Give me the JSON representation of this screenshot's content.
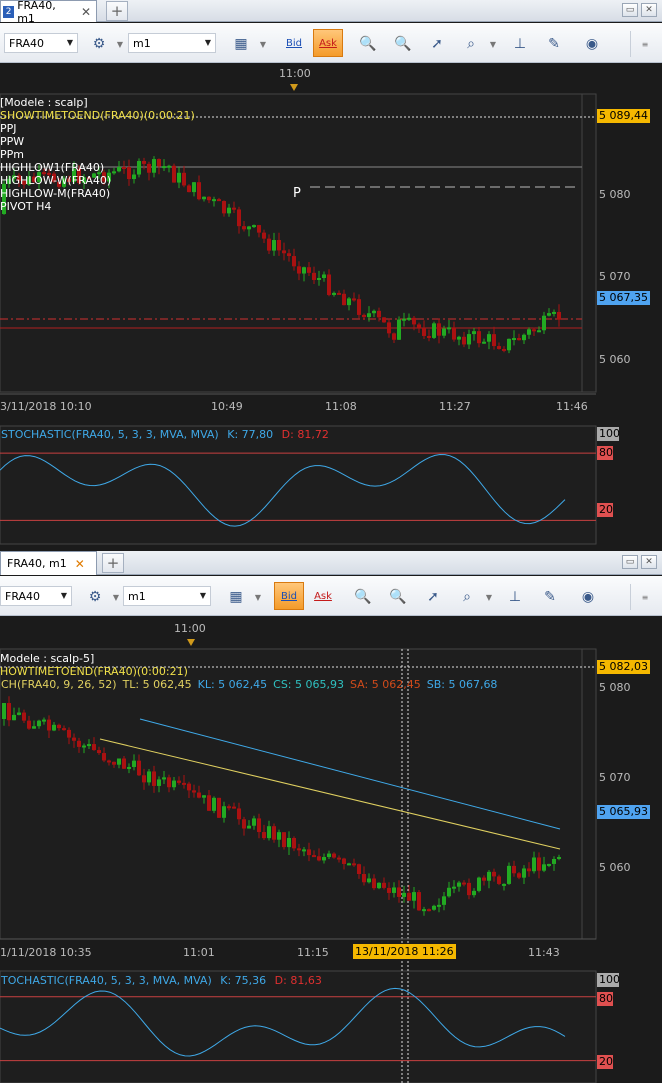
{
  "panel1": {
    "tab": {
      "num": "2",
      "title": "FRA40, m1",
      "close": "✕"
    },
    "add": "+",
    "window_buttons": [
      "▭",
      "✕"
    ],
    "toolbar": {
      "symbol": "FRA40",
      "timeframe": "m1",
      "bid": "Bid",
      "ask": "Ask",
      "bid_active": false,
      "ask_active": true
    },
    "top_time": "11:00",
    "labels": [
      "[Modele : scalp]",
      "SHOWTIMETOEND(FRA40)(0:00:21)",
      "PPJ",
      "PPW",
      "PPm",
      "HIGHLOW1(FRA40)",
      "HIGHLOW-W(FRA40)",
      "HIGHLOW-M(FRA40)",
      "PIVOT H4"
    ],
    "label_colors": [
      "#ffffff",
      "#f0e04a",
      "#ffffff",
      "#ffffff",
      "#ffffff",
      "#ffffff",
      "#ffffff",
      "#ffffff",
      "#ffffff"
    ],
    "pivot_marker": "P",
    "price_tags": [
      {
        "text": "5 089,44",
        "bg": "#f5b800"
      },
      {
        "text": "5 067,35",
        "bg": "#4fa3f0"
      }
    ],
    "price_axis": [
      "5 080",
      "5 070",
      "5 060"
    ],
    "time_axis": [
      "3/11/2018 10:10",
      "10:49",
      "11:08",
      "11:27",
      "11:46"
    ],
    "stoch": {
      "label": "STOCHASTIC(FRA40, 5, 3, 3, MVA, MVA)",
      "k_label": "K: 77,80",
      "d_label": "D: 81,72",
      "levels": [
        "100",
        "80",
        "20"
      ]
    }
  },
  "panel2": {
    "tab": {
      "num": "",
      "title": "FRA40, m1",
      "close": "✕"
    },
    "add": "+",
    "window_buttons": [
      "▭",
      "✕"
    ],
    "toolbar": {
      "symbol": "FRA40",
      "timeframe": "m1",
      "bid": "Bid",
      "ask": "Ask",
      "bid_active": true,
      "ask_active": false
    },
    "top_time": "11:00",
    "labels": [
      "Modele : scalp-5]",
      "HOWTIMETOEND(FRA40)(0:00:21)"
    ],
    "label_colors": [
      "#ffffff",
      "#f0e04a"
    ],
    "ich_line": [
      {
        "text": "CH(FRA40, 9, 26, 52)",
        "color": "#e0d060"
      },
      {
        "text": "TL: 5 062,45",
        "color": "#e0d060"
      },
      {
        "text": "KL: 5 062,45",
        "color": "#3fa9e8"
      },
      {
        "text": "CS: 5 065,93",
        "color": "#2fc0c0"
      },
      {
        "text": "SA: 5 062,45",
        "color": "#d04a1a"
      },
      {
        "text": "SB: 5 067,68",
        "color": "#3fa9e8"
      }
    ],
    "price_tags": [
      {
        "text": "5 082,03",
        "bg": "#f5b800"
      },
      {
        "text": "5 065,93",
        "bg": "#4fa3f0"
      }
    ],
    "price_axis": [
      "5 080",
      "5 070",
      "5 060"
    ],
    "time_axis": [
      "1/11/2018 10:35",
      "11:01",
      "11:15",
      "11:43"
    ],
    "cursor_time": "13/11/2018 11:26",
    "stoch": {
      "label": "TOCHASTIC(FRA40, 5, 3, 3, MVA, MVA)",
      "k_label": "K: 75,36",
      "d_label": "D: 81,63",
      "levels": [
        "100",
        "80",
        "20"
      ]
    }
  },
  "colors": {
    "bull": "#22aa22",
    "bear": "#aa1111",
    "stoch_line": "#3fa9e8",
    "level_line": "#c84040"
  }
}
